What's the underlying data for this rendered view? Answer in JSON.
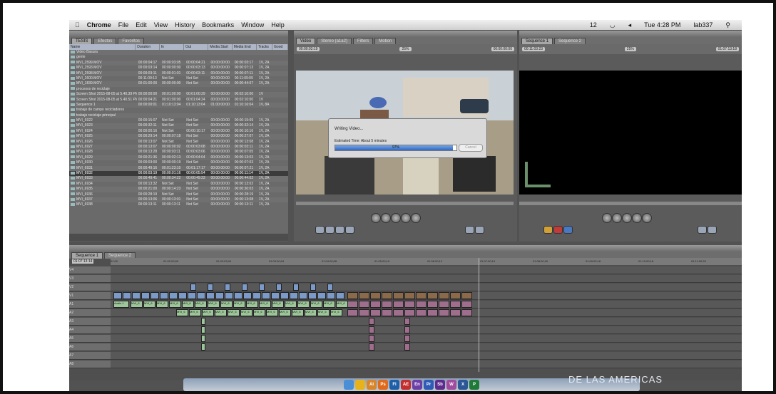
{
  "menubar": {
    "apple": "",
    "app": "Chrome",
    "items": [
      "File",
      "Edit",
      "View",
      "History",
      "Bookmarks",
      "Window",
      "Help"
    ],
    "status": {
      "battery": "12",
      "time": "Tue 4:28 PM",
      "user": "lab337"
    }
  },
  "browser": {
    "tabs": [
      "TESIS",
      "Efectos",
      "Favoritos"
    ],
    "columns": [
      "Name",
      "Duration",
      "In",
      "Out",
      "Media Start",
      "Media End",
      "Tracks",
      "Good"
    ],
    "rows": [
      {
        "name": "Video Basura",
        "vals": [
          "",
          "",
          "",
          "",
          "",
          "",
          ""
        ]
      },
      {
        "name": "gente",
        "vals": [
          "",
          "",
          "",
          "",
          "",
          "",
          ""
        ]
      },
      {
        "name": "MVI_2599.MOV",
        "vals": [
          "00:00:04:17",
          "00:00:03:05",
          "00:00:04:21",
          "00:00:00:00",
          "00:00:03:17",
          "1V, 2A",
          ""
        ]
      },
      {
        "name": "MVI_2593.MOV",
        "vals": [
          "00:00:03:14",
          "00:00:00:00",
          "00:00:03:13",
          "00:00:00:00",
          "00:00:07:13",
          "1V, 2A",
          ""
        ]
      },
      {
        "name": "MVI_2598.MOV",
        "vals": [
          "00:00:03:11",
          "00:00:01:01",
          "00:00:03:11",
          "00:00:00:00",
          "00:00:07:11",
          "1V, 2A",
          ""
        ]
      },
      {
        "name": "MVI_2600.MOV",
        "vals": [
          "00:11:09:13",
          "Not Set",
          "Not Set",
          "00:00:00:00",
          "00:11:09:09",
          "1V, 2A",
          ""
        ]
      },
      {
        "name": "MVI_1839.MOV",
        "vals": [
          "00:01:00:00",
          "00:00:00:00",
          "Not Set",
          "00:00:00:00",
          "00:00:44:07",
          "1V, 2A",
          ""
        ]
      },
      {
        "name": "procesos de reciclaje",
        "vals": [
          "",
          "",
          "",
          "",
          "",
          "",
          ""
        ]
      },
      {
        "name": "Screen Shot 2015-08-05 at 5.40.39 PM",
        "vals": [
          "00:00:00:00",
          "00:01:00:00",
          "00:01:00:29",
          "00:00:00:00",
          "00:02:10:00",
          "1V",
          ""
        ]
      },
      {
        "name": "Screen Shot 2015-08-05 at 5.40.51 PM",
        "vals": [
          "00:00:04:21",
          "00:01:00:00",
          "00:01:04:24",
          "00:00:00:00",
          "00:02:10:00",
          "1V",
          ""
        ]
      },
      {
        "name": "Sequence 1",
        "vals": [
          "00:00:00:01",
          "01:10:13:04",
          "01:10:13:04",
          "01:00:00:00",
          "01:10:16:04",
          "1V, 8A",
          ""
        ]
      },
      {
        "name": "trabajo de campo recicladores",
        "vals": [
          "",
          "",
          "",
          "",
          "",
          "",
          ""
        ]
      },
      {
        "name": "trabajo reciclaje principal",
        "vals": [
          "",
          "",
          "",
          "",
          "",
          "",
          ""
        ]
      },
      {
        "name": "MVI_6922",
        "vals": [
          "00:00:15:07",
          "Not Set",
          "Not Set",
          "00:00:00:00",
          "00:00:15:09",
          "1V, 2A",
          ""
        ]
      },
      {
        "name": "MVI_6923",
        "vals": [
          "00:00:32:11",
          "Not Set",
          "Not Set",
          "00:00:00:00",
          "00:00:32:14",
          "1V, 2A",
          ""
        ]
      },
      {
        "name": "MVI_6924",
        "vals": [
          "00:00:00:16",
          "Not Set",
          "00:00:10:17",
          "00:00:00:00",
          "00:00:10:16",
          "1V, 2A",
          ""
        ]
      },
      {
        "name": "MVI_6925",
        "vals": [
          "00:00:29:14",
          "00:00:07:18",
          "Not Set",
          "00:00:00:00",
          "00:00:27:07",
          "1V, 2A",
          ""
        ]
      },
      {
        "name": "MVI_6926",
        "vals": [
          "00:00:13:07",
          "Not Set",
          "Not Set",
          "00:00:00:00",
          "00:00:13:08",
          "1V, 2A",
          ""
        ]
      },
      {
        "name": "MVI_6927",
        "vals": [
          "00:00:13:07",
          "00:00:00:02",
          "00:00:03:08",
          "00:00:00:00",
          "00:00:03:11",
          "1V, 2A",
          ""
        ]
      },
      {
        "name": "MVI_6928",
        "vals": [
          "00:00:13:28",
          "00:00:03:11",
          "00:00:03:06",
          "00:00:00:00",
          "00:00:07:05",
          "1V, 2A",
          ""
        ]
      },
      {
        "name": "MVI_6929",
        "vals": [
          "00:00:21:36",
          "00:00:02:13",
          "00:00:04:04",
          "00:00:00:00",
          "00:00:13:03",
          "1V, 2A",
          ""
        ]
      },
      {
        "name": "MVI_6930",
        "vals": [
          "00:00:03:00",
          "00:00:00:19",
          "Not Set",
          "00:00:00:00",
          "00:00:07:03",
          "1V, 2A",
          ""
        ]
      },
      {
        "name": "MVI_6931",
        "vals": [
          "00:00:49:16",
          "00:01:23:10",
          "00:01:17:17",
          "00:00:00:00",
          "00:00:07:21",
          "1V, 2A",
          ""
        ]
      },
      {
        "name": "MVI_6932",
        "vals": [
          "00:00:03:19",
          "00:00:01:16",
          "00:00:05:54",
          "00:00:00:00",
          "00:00:11:14",
          "1V, 2A",
          ""
        ]
      },
      {
        "name": "MVI_6933",
        "vals": [
          "00:00:49:41",
          "00:00:34:22",
          "00:00:49:23",
          "00:00:00:00",
          "00:00:44:02",
          "1V, 2A",
          ""
        ]
      },
      {
        "name": "MVI_6934",
        "vals": [
          "00:00:13:32",
          "Not Set",
          "Not Set",
          "00:00:00:00",
          "00:00:13:02",
          "1V, 2A",
          ""
        ]
      },
      {
        "name": "MVI_6935",
        "vals": [
          "00:00:21:00",
          "00:00:14:23",
          "Not Set",
          "00:00:00:00",
          "00:00:30:03",
          "1V, 2A",
          ""
        ]
      },
      {
        "name": "MVI_6936",
        "vals": [
          "00:00:28:19",
          "Not Set",
          "Not Set",
          "00:00:00:00",
          "00:00:28:19",
          "1V, 2A",
          ""
        ]
      },
      {
        "name": "MVI_6937",
        "vals": [
          "00:00:13:06",
          "00:00:13:01",
          "Not Set",
          "00:00:00:00",
          "00:00:13:08",
          "1V, 2A",
          ""
        ]
      },
      {
        "name": "MVI_6938",
        "vals": [
          "00:00:13:11",
          "00:00:13:11",
          "Not Set",
          "00:00:00:00",
          "00:00:13:11",
          "1V, 2A",
          ""
        ]
      }
    ],
    "selected_index": 23
  },
  "viewer": {
    "tabs": [
      "Video",
      "Stereo (a1a2)",
      "Filters",
      "Motion"
    ],
    "timecode_left": "00:00:03:19",
    "zoom": "25%",
    "timecode_right": "00:00:00:00",
    "dialog": {
      "title": "Writing Video...",
      "estimate": "Estimated Time: About 5 minutes",
      "progress_label": "97%",
      "progress": 0.97,
      "cancel": "Cancel"
    }
  },
  "canvas": {
    "tabs": [
      "Sequence 1",
      "Sequence 2"
    ],
    "timecode_left": "00:11:03:23",
    "zoom": "25%",
    "timecode_right": "01:07:13:18"
  },
  "timeline": {
    "tabs": [
      "Sequence 1",
      "Sequence 2"
    ],
    "current_tc": "01:07:13:14",
    "ruler": [
      "01:00",
      "01:02:00;00",
      "01:02:03;04",
      "01:03:00;04",
      "01:04:00;08",
      "01:05:00;10",
      "01:06:00;12",
      "01:07:00;14",
      "01:08:00;16",
      "01:09:00;18",
      "01:10:00;18",
      "01:11:00;20"
    ],
    "video_tracks": [
      "V4",
      "V3",
      "V2",
      "V1"
    ],
    "audio_tracks": [
      "A1",
      "A2",
      "A3",
      "A4",
      "A5",
      "A6",
      "A7",
      "A8"
    ],
    "clip_labels": {
      "audio": "Audio 1",
      "mvi": "MVI_6"
    }
  },
  "dock": {
    "icons": [
      "finder",
      "chrome",
      "Ai",
      "Ps",
      "Fl",
      "AE",
      "En",
      "Pr",
      "Sb",
      "W",
      "X",
      "P"
    ]
  },
  "watermark": "DE LAS AMERICAS",
  "colors": {
    "accent": "#2f68c4",
    "video_clip": "#7c9ac8",
    "audio_clip": "#9dc79a",
    "pink_clip": "#9e6e8c"
  }
}
